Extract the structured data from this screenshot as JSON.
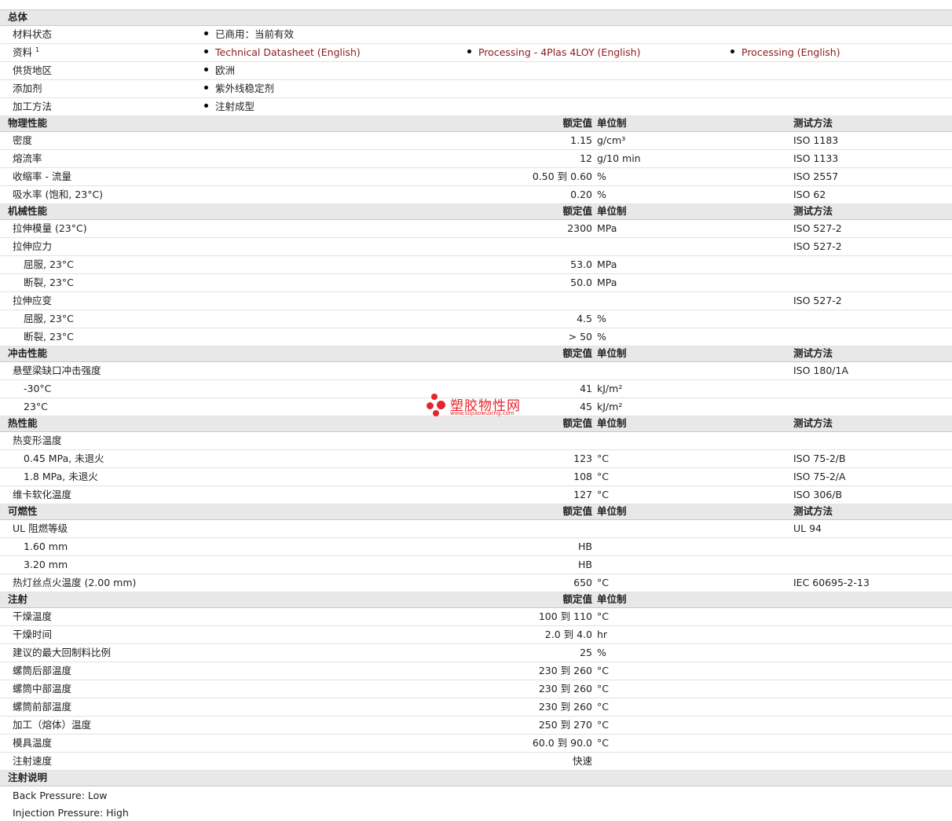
{
  "general": {
    "title": "总体",
    "status_label": "材料状态",
    "status_value": "已商用：当前有效",
    "docs_label": "资料",
    "docs_sup": "1",
    "docs": [
      "Technical Datasheet (English)",
      "Processing - 4Plas 4LOY (English)",
      "Processing (English)"
    ],
    "region_label": "供货地区",
    "region_value": "欧洲",
    "additive_label": "添加剂",
    "additive_value": "紫外线稳定剂",
    "method_label": "加工方法",
    "method_value": "注射成型"
  },
  "headers": {
    "nominal": "额定值",
    "unit": "单位制",
    "test": "测试方法"
  },
  "physical": {
    "title": "物理性能",
    "rows": [
      {
        "label": "密度",
        "value": "1.15",
        "unit": "g/cm³",
        "test": "ISO 1183"
      },
      {
        "label": "熔流率",
        "value": "12",
        "unit": "g/10 min",
        "test": "ISO 1133"
      },
      {
        "label": "收缩率 - 流量",
        "value": "0.50 到  0.60",
        "unit": "%",
        "test": "ISO 2557"
      },
      {
        "label": "吸水率 (饱和, 23°C)",
        "value": "0.20",
        "unit": "%",
        "test": "ISO 62"
      }
    ]
  },
  "mechanical": {
    "title": "机械性能",
    "rows": [
      {
        "label": "拉伸模量 (23°C)",
        "value": "2300",
        "unit": "MPa",
        "test": "ISO 527-2"
      },
      {
        "label": "拉伸应力",
        "value": "",
        "unit": "",
        "test": "ISO 527-2"
      },
      {
        "label": "屈服, 23°C",
        "value": "53.0",
        "unit": "MPa",
        "test": ""
      },
      {
        "label": "断裂, 23°C",
        "value": "50.0",
        "unit": "MPa",
        "test": ""
      },
      {
        "label": "拉伸应变",
        "value": "",
        "unit": "",
        "test": "ISO 527-2"
      },
      {
        "label": "屈服, 23°C",
        "value": "4.5",
        "unit": "%",
        "test": ""
      },
      {
        "label": "断裂, 23°C",
        "value": "> 50",
        "unit": "%",
        "test": ""
      }
    ]
  },
  "impact": {
    "title": "冲击性能",
    "rows": [
      {
        "label": "悬壁梁缺口冲击强度",
        "value": "",
        "unit": "",
        "test": "ISO 180/1A"
      },
      {
        "label": "-30°C",
        "value": "41",
        "unit": "kJ/m²",
        "test": ""
      },
      {
        "label": "23°C",
        "value": "45",
        "unit": "kJ/m²",
        "test": ""
      }
    ]
  },
  "thermal": {
    "title": "热性能",
    "rows": [
      {
        "label": "热变形温度",
        "value": "",
        "unit": "",
        "test": ""
      },
      {
        "label": "0.45 MPa, 未退火",
        "value": "123",
        "unit": "°C",
        "test": "ISO 75-2/B"
      },
      {
        "label": "1.8 MPa, 未退火",
        "value": "108",
        "unit": "°C",
        "test": "ISO 75-2/A"
      },
      {
        "label": "维卡软化温度",
        "value": "127",
        "unit": "°C",
        "test": "ISO 306/B"
      }
    ]
  },
  "flammability": {
    "title": "可燃性",
    "rows": [
      {
        "label": "UL 阻燃等级",
        "value": "",
        "unit": "",
        "test": "UL 94"
      },
      {
        "label": "1.60 mm",
        "value": "HB",
        "unit": "",
        "test": ""
      },
      {
        "label": "3.20 mm",
        "value": "HB",
        "unit": "",
        "test": ""
      },
      {
        "label": "热灯丝点火温度 (2.00 mm)",
        "value": "650",
        "unit": "°C",
        "test": "IEC 60695-2-13"
      }
    ]
  },
  "injection": {
    "title": "注射",
    "rows": [
      {
        "label": "干燥温度",
        "value": "100 到  110",
        "unit": "°C",
        "test": ""
      },
      {
        "label": "干燥时间",
        "value": "2.0 到  4.0",
        "unit": "hr",
        "test": ""
      },
      {
        "label": "建议的最大回制料比例",
        "value": "25",
        "unit": "%",
        "test": ""
      },
      {
        "label": "螺筒后部温度",
        "value": "230 到  260",
        "unit": "°C",
        "test": ""
      },
      {
        "label": "螺筒中部温度",
        "value": "230 到  260",
        "unit": "°C",
        "test": ""
      },
      {
        "label": "螺筒前部温度",
        "value": "230 到  260",
        "unit": "°C",
        "test": ""
      },
      {
        "label": "加工（熔体）温度",
        "value": "250 到  270",
        "unit": "°C",
        "test": ""
      },
      {
        "label": "模具温度",
        "value": "60.0 到  90.0",
        "unit": "°C",
        "test": ""
      },
      {
        "label": "注射速度",
        "value": "快速",
        "unit": "",
        "test": ""
      }
    ]
  },
  "injection_notes": {
    "title": "注射说明",
    "lines": [
      "Back Pressure: Low",
      "Injection Pressure: High"
    ]
  },
  "watermark": {
    "text": "塑胶物性网",
    "url": "www.sujiaowuxing.com",
    "color": "#e8242b"
  }
}
